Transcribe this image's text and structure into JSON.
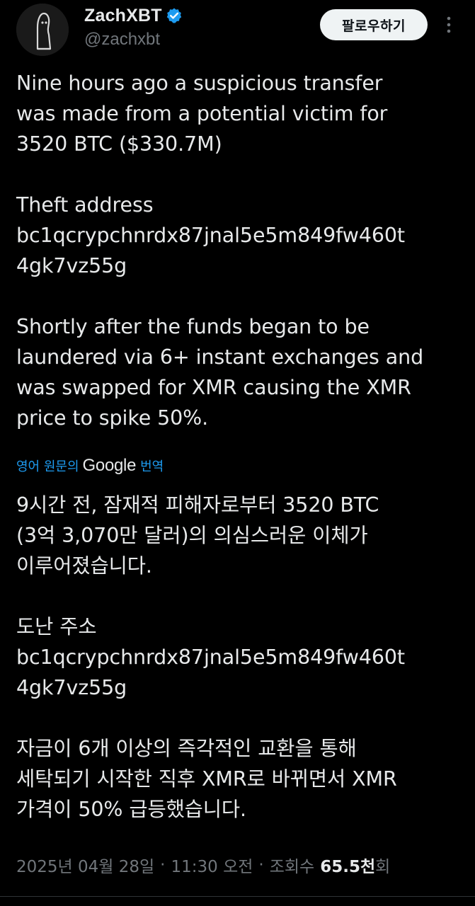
{
  "author": {
    "display_name": "ZachXBT",
    "handle": "@zachxbt",
    "verified": true,
    "avatar_icon": "ghost-figure-avatar"
  },
  "actions": {
    "follow_label": "팔로우하기",
    "more_icon": "vertical-ellipsis-icon"
  },
  "post": {
    "original_text": "Nine hours ago a suspicious transfer\nwas made from a potential victim for\n3520 BTC ($330.7M)\n\nTheft address\nbc1qcrypchnrdx87jnal5e5m849fw460t\n4gk7vz55g\n\nShortly after the funds began to be\nlaundered via 6+ instant exchanges and\nwas swapped for XMR causing the XMR\nprice to spike 50%.",
    "translation_source_label": "영어 원문의",
    "translation_provider": "Google",
    "translation_suffix": "번역",
    "translated_text": "9시간 전, 잠재적 피해자로부터 3520 BTC\n(3억 3,070만 달러)의 의심스러운 이체가\n이루어졌습니다.\n\n도난 주소\nbc1qcrypchnrdx87jnal5e5m849fw460t\n4gk7vz55g\n\n자금이 6개 이상의 즉각적인 교환을 통해\n세탁되기 시작한 직후 XMR로 바뀌면서 XMR\n가격이 50% 급등했습니다."
  },
  "meta": {
    "date": "2025년 04월 28일",
    "separator": "·",
    "time": "11:30 오전",
    "views_label": "조회수",
    "views_count": "65.5천",
    "views_suffix": "회"
  },
  "colors": {
    "background": "#000000",
    "text_primary": "#e7e9ea",
    "text_secondary": "#71767b",
    "accent_link": "#1d9bf0",
    "verified_badge": "#1d9bf0",
    "button_bg": "#eff3f4"
  }
}
